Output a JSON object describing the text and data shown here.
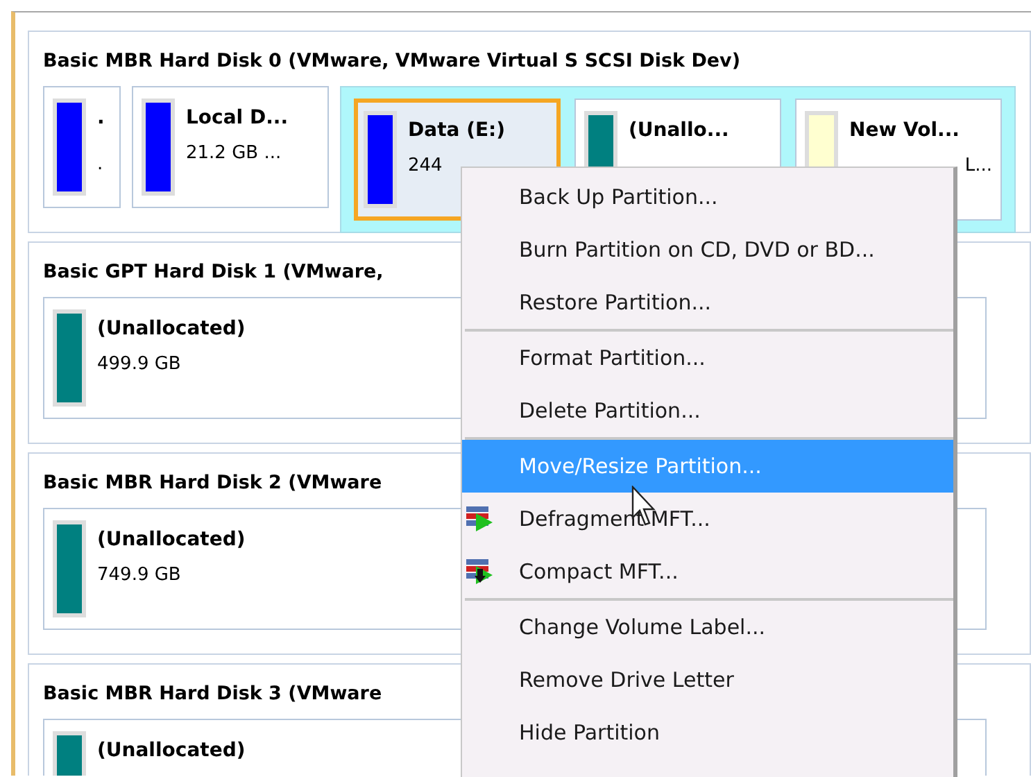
{
  "disks": [
    {
      "title": "Basic MBR Hard Disk 0 (VMware, VMware Virtual S SCSI Disk Dev)",
      "partitions": [
        {
          "name": ".",
          "detail": ".",
          "color": "#0000ff",
          "selected": false,
          "kind": "tiny"
        },
        {
          "name": "Local D...",
          "detail": "21.2 GB ...",
          "color": "#0000ff",
          "selected": false,
          "kind": "normal"
        }
      ],
      "extended_partitions": [
        {
          "name": "Data (E:)",
          "detail": "244",
          "color": "#0000ff",
          "selected": true,
          "kind": "fill"
        },
        {
          "name": "(Unallo...",
          "color": "#008080",
          "selected": false,
          "kind": "fill"
        },
        {
          "name": "New Vol...",
          "detail": "L...",
          "color": "#ffffd0",
          "selected": false,
          "kind": "fill"
        }
      ]
    },
    {
      "title": "Basic GPT Hard Disk 1 (VMware,",
      "partitions": [
        {
          "name": "(Unallocated)",
          "detail": "499.9 GB",
          "color": "#008080",
          "selected": false,
          "kind": "wide"
        }
      ]
    },
    {
      "title": "Basic MBR Hard Disk 2 (VMware",
      "partitions": [
        {
          "name": "(Unallocated)",
          "detail": "749.9 GB",
          "color": "#008080",
          "selected": false,
          "kind": "wide"
        }
      ]
    },
    {
      "title": "Basic MBR Hard Disk 3 (VMware",
      "partitions": [
        {
          "name": "(Unallocated)",
          "color": "#008080",
          "selected": false,
          "kind": "wide"
        }
      ]
    }
  ],
  "context_menu": {
    "sections": [
      [
        {
          "label": "Back Up Partition...",
          "kind": "plain",
          "selected": false
        },
        {
          "label": "Burn Partition on CD, DVD or BD...",
          "kind": "plain",
          "selected": false
        },
        {
          "label": "Restore Partition...",
          "kind": "plain",
          "selected": false
        }
      ],
      [
        {
          "label": "Format Partition...",
          "kind": "plain",
          "selected": false
        },
        {
          "label": "Delete Partition...",
          "kind": "plain",
          "selected": false
        }
      ],
      [
        {
          "label": "Move/Resize Partition...",
          "kind": "plain",
          "selected": true
        },
        {
          "label": "Defragment MFT...",
          "kind": "defrag",
          "selected": false
        },
        {
          "label": "Compact MFT...",
          "kind": "compact",
          "selected": false
        }
      ],
      [
        {
          "label": "Change Volume Label...",
          "kind": "plain",
          "selected": false
        },
        {
          "label": "Remove Drive Letter",
          "kind": "plain",
          "selected": false
        },
        {
          "label": "Hide Partition",
          "kind": "plain",
          "selected": false
        }
      ]
    ]
  }
}
